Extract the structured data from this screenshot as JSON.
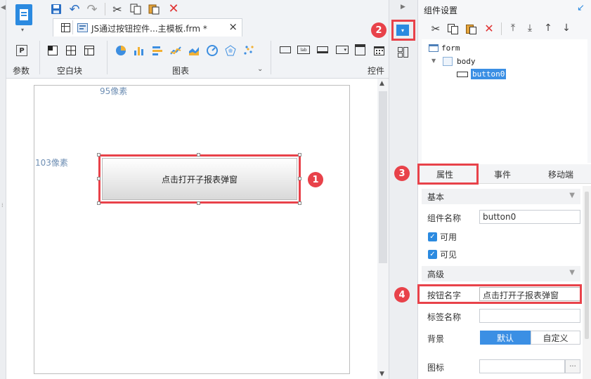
{
  "document_tab": {
    "title": "JS通过按钮控件...主模板.frm *"
  },
  "ribbon": {
    "groups": [
      {
        "label": "参数"
      },
      {
        "label": "空白块"
      },
      {
        "label": "图表"
      },
      {
        "label": "控件"
      }
    ]
  },
  "canvas": {
    "top_offset_label": "95像素",
    "left_offset_label": "103像素",
    "button_text": "点击打开子报表弹窗"
  },
  "callouts": [
    "1",
    "2",
    "3",
    "4"
  ],
  "panel": {
    "title": "组件设置",
    "tree": {
      "root": "form",
      "body": "body",
      "selected": "button0"
    },
    "tabs": [
      "属性",
      "事件",
      "移动端"
    ],
    "section_basic": "基本",
    "widget_name_label": "组件名称",
    "widget_name_value": "button0",
    "enabled_label": "可用",
    "visible_label": "可见",
    "section_advanced": "高级",
    "button_name_label": "按钮名字",
    "button_name_value": "点击打开子报表弹窗",
    "tag_name_label": "标签名称",
    "tag_name_value": "",
    "background_label": "背景",
    "background_default": "默认",
    "background_custom": "自定义",
    "icon_label": "图标",
    "icon_value": "",
    "browse_label": "···"
  },
  "colors": {
    "accent": "#2b8ae0",
    "highlight": "#e8424a",
    "selection_fill": "#3b8fe4"
  }
}
